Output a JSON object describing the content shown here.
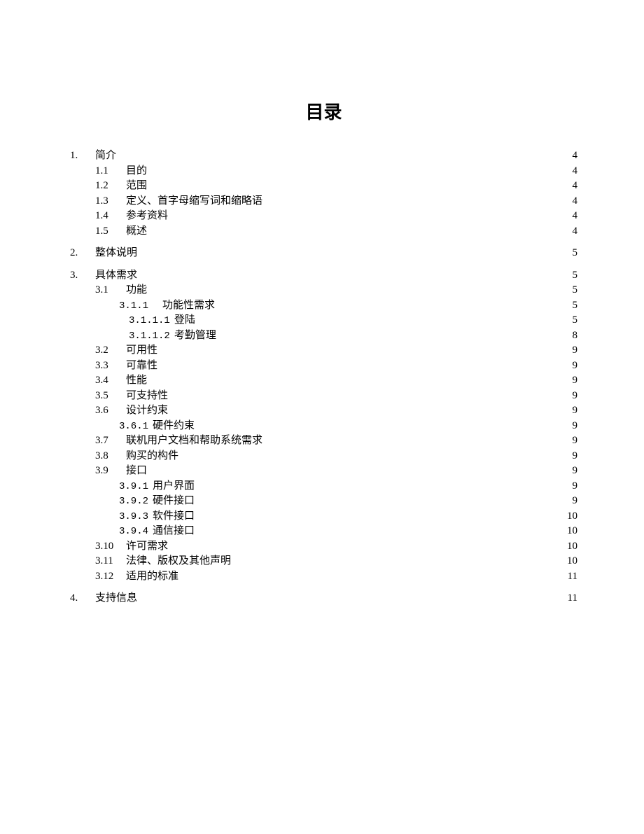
{
  "title": "目录",
  "entries": [
    {
      "level": 0,
      "num": "1.",
      "text": "简介",
      "page": "4",
      "top": true
    },
    {
      "level": 1,
      "num": "1.1",
      "text": "目的",
      "page": "4"
    },
    {
      "level": 1,
      "num": "1.2",
      "text": "范围",
      "page": "4"
    },
    {
      "level": 1,
      "num": "1.3",
      "text": "定义、首字母缩写词和缩略语",
      "page": "4"
    },
    {
      "level": 1,
      "num": "1.4",
      "text": "参考资料",
      "page": "4"
    },
    {
      "level": 1,
      "num": "1.5",
      "text": "概述",
      "page": "4",
      "gapAfter": true
    },
    {
      "level": 0,
      "num": "2.",
      "text": "整体说明",
      "page": "5",
      "top": true,
      "gapAfter": true
    },
    {
      "level": 0,
      "num": "3.",
      "text": "具体需求",
      "page": "5",
      "top": true
    },
    {
      "level": 1,
      "num": "3.1",
      "text": "功能",
      "page": "5"
    },
    {
      "level": 2,
      "num": "3.1.1",
      "text": "功能性需求",
      "page": "5",
      "mono": true
    },
    {
      "level": 3,
      "num": "3.1.1.1",
      "text": "登陆",
      "page": "5",
      "mono": true
    },
    {
      "level": 3,
      "num": "3.1.1.2",
      "text": "考勤管理",
      "page": "8",
      "mono": true
    },
    {
      "level": 1,
      "num": "3.2",
      "text": "可用性",
      "page": "9"
    },
    {
      "level": 1,
      "num": "3.3",
      "text": "可靠性",
      "page": "9"
    },
    {
      "level": 1,
      "num": "3.4",
      "text": "性能",
      "page": "9"
    },
    {
      "level": 1,
      "num": "3.5",
      "text": "可支持性",
      "page": "9"
    },
    {
      "level": 1,
      "num": "3.6",
      "text": "设计约束",
      "page": "9"
    },
    {
      "level": 3,
      "num": "3.6.1",
      "text": "硬件约束",
      "page": "9",
      "mono": true,
      "variant": "b"
    },
    {
      "level": 1,
      "num": "3.7",
      "text": "联机用户文档和帮助系统需求",
      "page": "9"
    },
    {
      "level": 1,
      "num": "3.8",
      "text": "购买的构件",
      "page": "9"
    },
    {
      "level": 1,
      "num": "3.9",
      "text": "接口",
      "page": "9"
    },
    {
      "level": 3,
      "num": "3.9.1",
      "text": "用户界面",
      "page": "9",
      "mono": true,
      "variant": "b"
    },
    {
      "level": 3,
      "num": "3.9.2",
      "text": "硬件接口",
      "page": "9",
      "mono": true,
      "variant": "b"
    },
    {
      "level": 3,
      "num": "3.9.3",
      "text": "软件接口",
      "page": "10",
      "mono": true,
      "variant": "b"
    },
    {
      "level": 3,
      "num": "3.9.4",
      "text": "通信接口",
      "page": "10",
      "mono": true,
      "variant": "b"
    },
    {
      "level": 1,
      "num": "3.10",
      "text": "许可需求",
      "page": "10"
    },
    {
      "level": 1,
      "num": "3.11",
      "text": "法律、版权及其他声明",
      "page": "10"
    },
    {
      "level": 1,
      "num": "3.12",
      "text": "适用的标准",
      "page": "11",
      "gapAfter": true
    },
    {
      "level": 0,
      "num": "4.",
      "text": "支持信息",
      "page": "11",
      "top": true
    }
  ]
}
